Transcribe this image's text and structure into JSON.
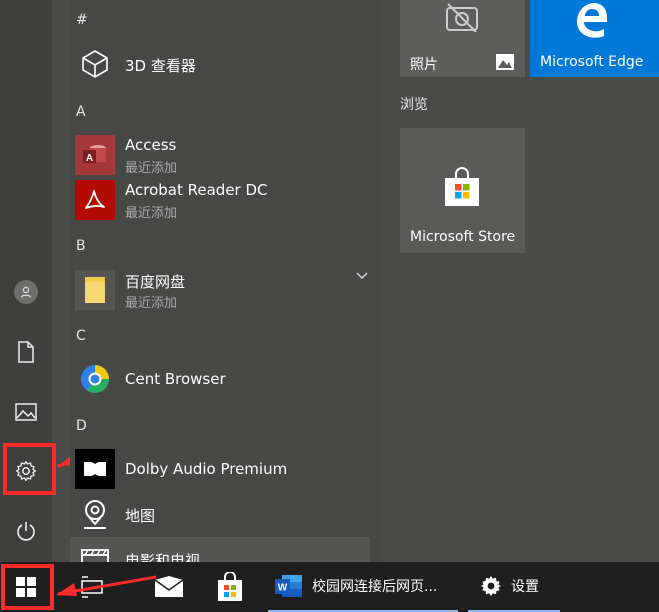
{
  "start_menu": {
    "sections": [
      {
        "letter": "#",
        "apps": [
          {
            "name": "3D 查看器",
            "subtitle": ""
          }
        ]
      },
      {
        "letter": "A",
        "apps": [
          {
            "name": "Access",
            "subtitle": "最近添加"
          },
          {
            "name": "Acrobat Reader DC",
            "subtitle": "最近添加"
          }
        ]
      },
      {
        "letter": "B",
        "apps": [
          {
            "name": "百度网盘",
            "subtitle": "最近添加"
          }
        ]
      },
      {
        "letter": "C",
        "apps": [
          {
            "name": "Cent Browser",
            "subtitle": ""
          }
        ]
      },
      {
        "letter": "D",
        "apps": [
          {
            "name": "Dolby Audio Premium",
            "subtitle": ""
          },
          {
            "name": "地图",
            "subtitle": ""
          },
          {
            "name": "电影和电视",
            "subtitle": ""
          }
        ]
      }
    ],
    "tiles": {
      "photos": "照片",
      "edge": "Microsoft Edge",
      "group_browse": "浏览",
      "store": "Microsoft Store"
    }
  },
  "taskbar": {
    "word_window": "校园网连接后网页...",
    "settings_window": "设置"
  },
  "colors": {
    "accent": "#0078d7",
    "highlight": "#ff2a2a",
    "access_red": "#a4373a",
    "acrobat_red": "#b30b00"
  }
}
